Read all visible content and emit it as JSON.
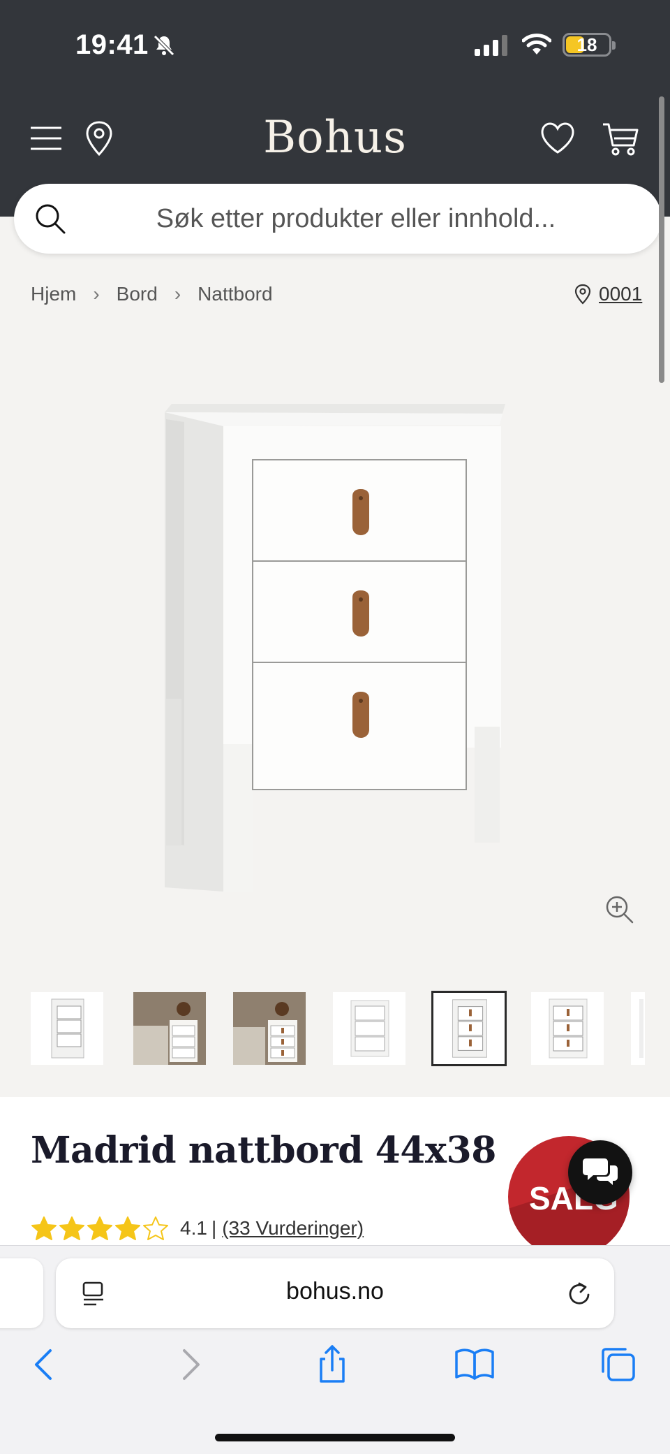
{
  "status_bar": {
    "time": "19:41",
    "battery": "18"
  },
  "header": {
    "logo": "Bohus"
  },
  "search": {
    "placeholder": "Søk etter produkter eller innhold..."
  },
  "breadcrumb": {
    "items": [
      "Hjem",
      "Bord",
      "Nattbord"
    ],
    "store": "0001"
  },
  "product": {
    "title": "Madrid nattbord 44x38",
    "rating_value": "4.1",
    "rating_stars": 4.1,
    "reviews": "(33 Vurderinger)",
    "sale_badge": "SALG",
    "thumbnail_count": 7,
    "selected_thumbnail": 5
  },
  "browser": {
    "url": "bohus.no"
  },
  "colors": {
    "header_bg": "#33363b",
    "sale_red": "#c2272d",
    "star_yellow": "#f5c518",
    "ios_blue": "#1a7ef5"
  }
}
